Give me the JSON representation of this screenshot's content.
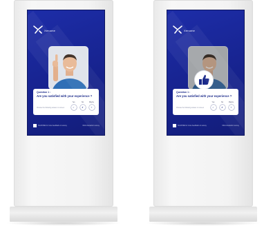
{
  "screens": [
    {
      "brand": "Xenome",
      "question_label": "Question 1 :",
      "question_text": "Are you satisfied with your experience ?",
      "hint": "Choose the following answer on screen",
      "answers": [
        {
          "label": "Yes",
          "symbol": "✓"
        },
        {
          "label": "No",
          "symbol": "✗"
        },
        {
          "label": "Maybe",
          "symbol": "?"
        }
      ],
      "footer_left": "SCAN ME for more feedback on survey",
      "footer_right": "Click interaction survey",
      "show_thumb_feedback": false
    },
    {
      "brand": "Xenome",
      "question_label": "Question 1 :",
      "question_text": "Are you satisfied with your experience ?",
      "hint": "Choose the following answer on screen",
      "answers": [
        {
          "label": "Yes",
          "symbol": "✓"
        },
        {
          "label": "No",
          "symbol": "✗"
        },
        {
          "label": "Maybe",
          "symbol": "?"
        }
      ],
      "footer_left": "SCAN ME for more feedback on survey",
      "footer_right": "Click interaction survey",
      "show_thumb_feedback": true
    }
  ],
  "colors": {
    "screen_blue": "#1a2a9c",
    "card_text": "#1b2a8a",
    "kiosk_body": "#f3f3f3"
  }
}
